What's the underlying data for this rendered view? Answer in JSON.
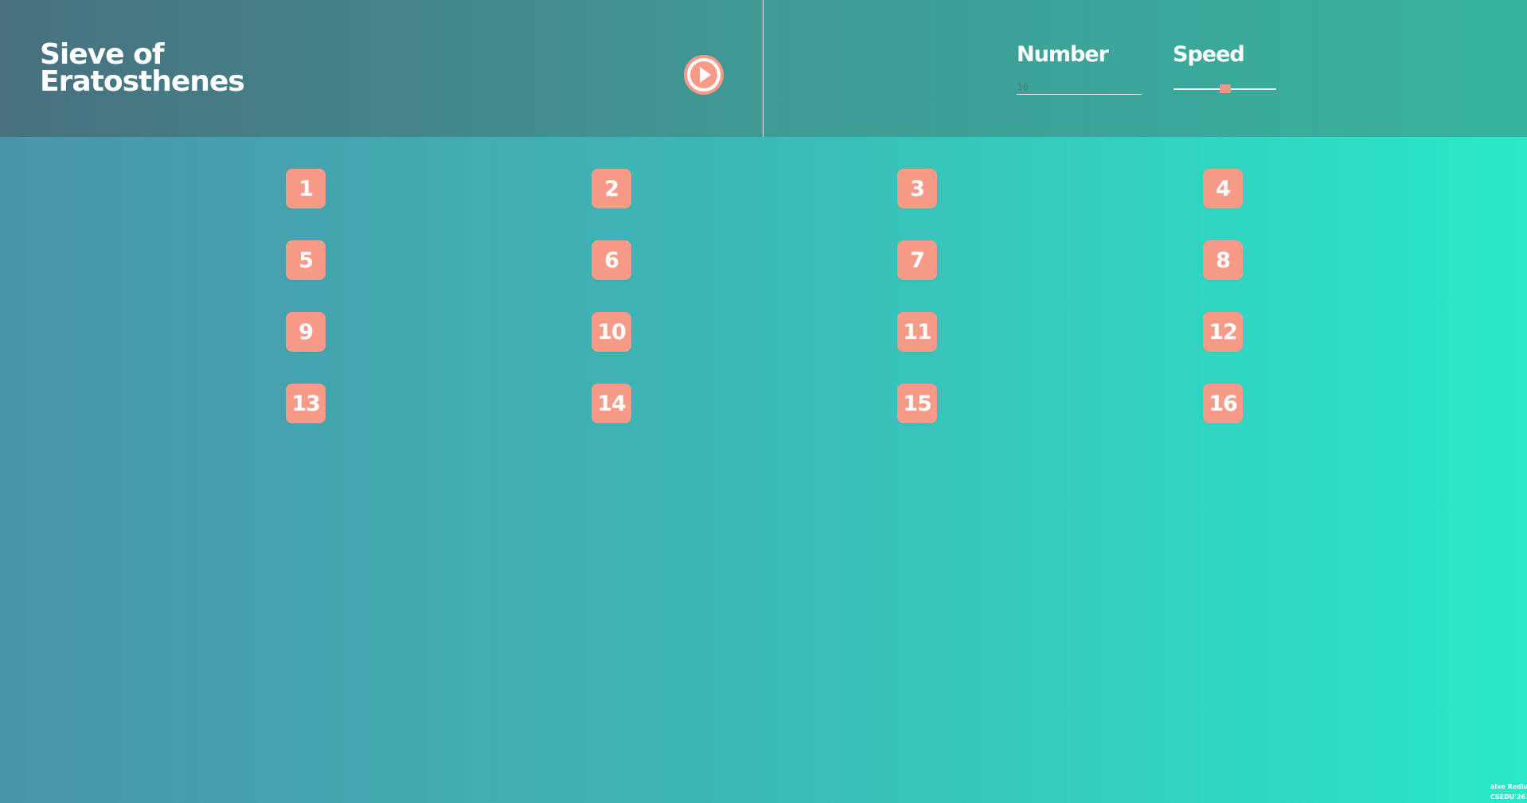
{
  "header": {
    "title_line1": "Sieve of",
    "title_line2": "Eratosthenes",
    "play_icon": "play-icon",
    "accent_color": "#f79b88"
  },
  "controls": {
    "number_label": "Number",
    "number_value": "",
    "number_placeholder": "16",
    "speed_label": "Speed",
    "speed_level": 0.5
  },
  "grid": {
    "cells": [
      "1",
      "2",
      "3",
      "4",
      "5",
      "6",
      "7",
      "8",
      "9",
      "10",
      "11",
      "12",
      "13",
      "14",
      "15",
      "16"
    ]
  },
  "footer": {
    "line1": "alve Rediuar",
    "line2": "CSEDU'26"
  }
}
